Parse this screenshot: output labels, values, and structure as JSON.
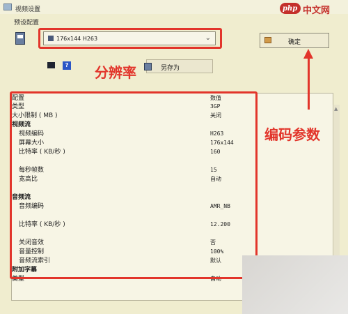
{
  "window": {
    "title": "视频设置"
  },
  "watermark": {
    "logo": "php",
    "text": "中文网"
  },
  "preset": {
    "label": "预设配置",
    "selected": "176x144 H263",
    "ok_label": "确定",
    "save_as_label": "另存为"
  },
  "annotations": {
    "resolution": "分辨率",
    "encoding_params": "编码参数"
  },
  "table": {
    "header": {
      "name": "配置",
      "value": "数值"
    },
    "rows": [
      {
        "name": "类型",
        "value": "3GP",
        "style": "normal"
      },
      {
        "name": "大小限制 ( MB )",
        "value": "关闭",
        "style": "normal"
      },
      {
        "name": "视频流",
        "value": "",
        "style": "section"
      },
      {
        "name": "视频编码",
        "value": "H263",
        "style": "normal"
      },
      {
        "name": "屏幕大小",
        "value": "176x144",
        "style": "normal"
      },
      {
        "name": "比特率 ( KB/秒 )",
        "value": "160",
        "style": "normal"
      },
      {
        "name": "",
        "value": "",
        "style": "faded"
      },
      {
        "name": "每秒帧数",
        "value": "15",
        "style": "normal"
      },
      {
        "name": "宽高比",
        "value": "自动",
        "style": "normal"
      },
      {
        "name": "",
        "value": "",
        "style": "faded"
      },
      {
        "name": "音频流",
        "value": "",
        "style": "section"
      },
      {
        "name": "音频编码",
        "value": "AMR_NB",
        "style": "normal"
      },
      {
        "name": "",
        "value": "",
        "style": "faded"
      },
      {
        "name": "比特率 ( KB/秒 )",
        "value": "12.200",
        "style": "normal"
      },
      {
        "name": "",
        "value": "",
        "style": "faded"
      },
      {
        "name": "关闭音效",
        "value": "否",
        "style": "normal"
      },
      {
        "name": "音量控制",
        "value": "100%",
        "style": "normal"
      },
      {
        "name": "音频流索引",
        "value": "默认",
        "style": "normal"
      },
      {
        "name": "附加字幕",
        "value": "",
        "style": "section"
      },
      {
        "name": "类型",
        "value": "自动",
        "style": "normal"
      }
    ]
  }
}
